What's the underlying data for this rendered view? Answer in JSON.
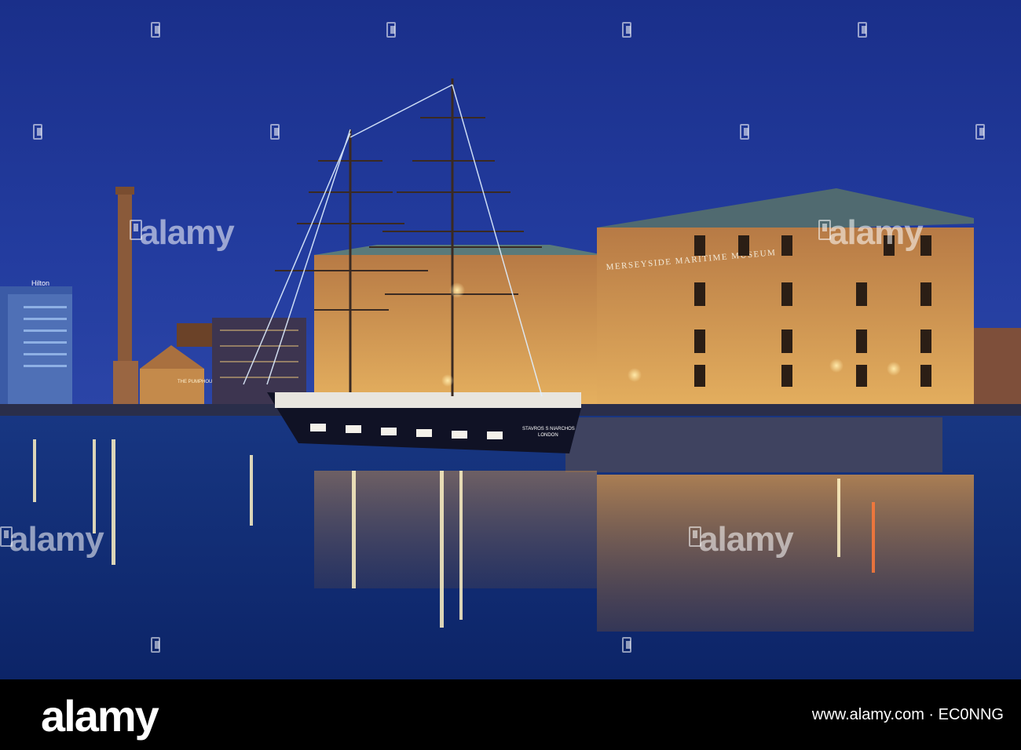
{
  "photo": {
    "subject": "Merseyside Maritime Museum at dusk",
    "building_sign": "MERSEYSIDE  MARITIME  MUSEUM",
    "pumphouse_sign": "THE PUMPHOUSE",
    "hotel_sign": "Hilton",
    "ship_name": "STAVROS S NIARCHOS",
    "ship_port": "LONDON",
    "sky_color": "#1d3592",
    "water_color": "#0f2a78",
    "brick_lit_color": "#d9a25a"
  },
  "watermark": {
    "brand": "alamy",
    "tile_text": "alamy"
  },
  "footer": {
    "logo": "alamy",
    "meta": "www.alamy.com · EC0NNG"
  }
}
